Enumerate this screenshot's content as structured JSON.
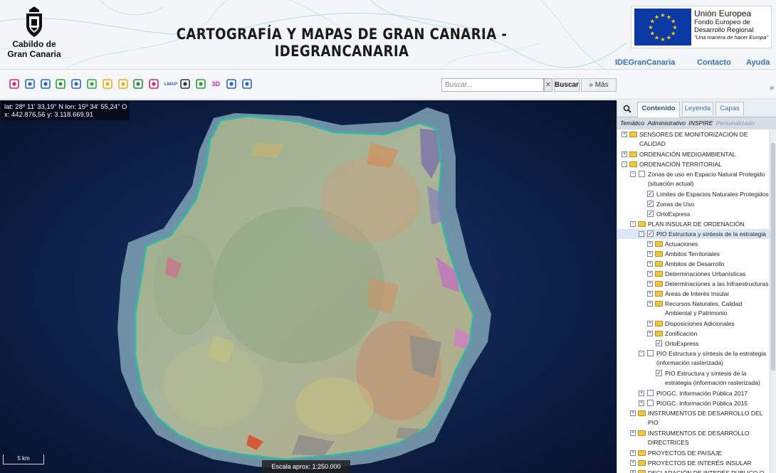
{
  "header": {
    "org_name_line1": "Cabildo de",
    "org_name_line2": "Gran Canaria",
    "title": "CARTOGRAFÍA Y MAPAS DE GRAN CANARIA - IDEGRANCANARIA",
    "eu": {
      "line1": "Unión Europea",
      "line2": "Fondo Europeo de",
      "line3": "Desarrollo Regional",
      "line4": "\"Una manera de hacer Europa\""
    },
    "links": [
      "IDEGranCanaria",
      "Contacto",
      "Ayuda"
    ]
  },
  "toolbar": {
    "tools": [
      {
        "icon": "zoom-extent-icon",
        "color": "#d02a7a"
      },
      {
        "icon": "zoom-in-icon",
        "color": "#2f62c8"
      },
      {
        "icon": "zoom-out-icon",
        "color": "#2f62c8"
      },
      {
        "icon": "globe-icon",
        "color": "#2e9a3a"
      },
      {
        "icon": "arrow-left-icon",
        "color": "#2f62c8"
      },
      {
        "icon": "binoculars-icon",
        "color": "#3aa640"
      },
      {
        "icon": "ruler-icon",
        "color": "#e6b121"
      },
      {
        "icon": "area-ruler-icon",
        "color": "#e6b121"
      },
      {
        "icon": "profile-icon",
        "color": "#2e8a3a"
      },
      {
        "icon": "print-icon",
        "color": "#d02a7a"
      },
      {
        "icon": "label-icon",
        "text": "LMAP",
        "color": "#2f62c8"
      },
      {
        "icon": "copy-icon",
        "color": "#333333"
      },
      {
        "icon": "layers-icon",
        "color": "#2e9a3a"
      },
      {
        "icon": "3d-icon",
        "text": "3D",
        "color": "#c02ab8"
      },
      {
        "icon": "split-icon",
        "color": "#2f62c8"
      },
      {
        "icon": "share-icon",
        "color": "#2f62c8"
      }
    ],
    "search_placeholder": "Buscar...",
    "search_button": "Buscar",
    "more_button": "Más"
  },
  "map": {
    "coords_line1": "lat: 28º 11' 33,19\" N  lon: 15º 34' 55,24\" O",
    "coords_line2": "x: 442.876,56  y: 3.118.669,91",
    "scalebar_label": "5 km",
    "scale_text": "Escala aprox: 1:250.000"
  },
  "sidebar": {
    "tabs": [
      "Contenido",
      "Leyenda",
      "Capas"
    ],
    "subtabs": [
      "Temático",
      "Administrativo",
      "INSPIRE",
      "Personalizado"
    ],
    "tree": [
      {
        "level": 0,
        "exp": "+",
        "icon": "folder",
        "label": "SENSORES DE MONITORIZACIÓN DE"
      },
      {
        "level": 0,
        "cont": true,
        "label": "CALIDAD"
      },
      {
        "level": 0,
        "exp": "+",
        "icon": "folder",
        "label": "ORDENACIÓN MEDIOAMBIENTAL"
      },
      {
        "level": 0,
        "exp": "-",
        "icon": "folder",
        "label": "ORDENACIÓN TERRITORIAL"
      },
      {
        "level": 1,
        "exp": "-",
        "icon": "check",
        "checked": false,
        "label": "Zonas de uso en Espacio Natural Protegido"
      },
      {
        "level": 1,
        "cont": true,
        "label": "(situación actual)"
      },
      {
        "level": 2,
        "icon": "check",
        "checked": true,
        "label": "Límites de Espacios Naturales Protegidos"
      },
      {
        "level": 2,
        "icon": "check",
        "checked": true,
        "label": "Zonas de Uso"
      },
      {
        "level": 2,
        "icon": "check",
        "checked": true,
        "label": "OrtoExpress"
      },
      {
        "level": 1,
        "exp": "-",
        "icon": "folder",
        "label": "PLAN INSULAR DE ORDENACIÓN"
      },
      {
        "level": 2,
        "exp": "-",
        "icon": "check",
        "checked": true,
        "hl": true,
        "label": "PIO Estructura y síntesis de la estrategia"
      },
      {
        "level": 3,
        "exp": "+",
        "icon": "folder",
        "label": "Actuaciones"
      },
      {
        "level": 3,
        "exp": "+",
        "icon": "folder",
        "label": "Ámbitos Territoriales"
      },
      {
        "level": 3,
        "exp": "+",
        "icon": "folder",
        "label": "Ámbitos de Desarrollo"
      },
      {
        "level": 3,
        "exp": "+",
        "icon": "folder",
        "label": "Determinaciones Urbanísticas"
      },
      {
        "level": 3,
        "exp": "+",
        "icon": "folder",
        "label": "Determinaciones a las Infraestructuras"
      },
      {
        "level": 3,
        "exp": "+",
        "icon": "folder",
        "label": "Áreas de Interés Insular"
      },
      {
        "level": 3,
        "exp": "+",
        "icon": "folder",
        "label": "Recursos Naturales, Calidad"
      },
      {
        "level": 3,
        "cont": true,
        "label": "Ambiental y Patrimonio"
      },
      {
        "level": 3,
        "exp": "+",
        "icon": "folder",
        "label": "Disposiciones Adicionales"
      },
      {
        "level": 3,
        "exp": "+",
        "icon": "folder",
        "label": "Zonificación"
      },
      {
        "level": 3,
        "icon": "check",
        "checked": true,
        "label": "OrtoExpress"
      },
      {
        "level": 2,
        "exp": "-",
        "icon": "check",
        "checked": false,
        "label": "PIO Estructura y síntesis de la estrategia"
      },
      {
        "level": 2,
        "cont": true,
        "label": "(información rasterizada)"
      },
      {
        "level": 3,
        "icon": "check",
        "checked": true,
        "label": "PIO Estructura y síntesis de la"
      },
      {
        "level": 3,
        "cont": true,
        "label": "estrategia (información rasterizada)"
      },
      {
        "level": 2,
        "exp": "+",
        "icon": "check",
        "checked": false,
        "label": "PIOGC. Información Pública 2017"
      },
      {
        "level": 2,
        "exp": "+",
        "icon": "check",
        "checked": false,
        "label": "PIOGC. Información Pública 2015"
      },
      {
        "level": 1,
        "exp": "+",
        "icon": "folder",
        "label": "INSTRUMENTOS DE DESARROLLO DEL"
      },
      {
        "level": 1,
        "cont": true,
        "label": "PIO"
      },
      {
        "level": 1,
        "exp": "+",
        "icon": "folder",
        "label": "INSTRUMENTOS DE DESARROLLO"
      },
      {
        "level": 1,
        "cont": true,
        "label": "DIRECTRICES"
      },
      {
        "level": 1,
        "exp": "+",
        "icon": "folder",
        "label": "PROYECTOS DE PAISAJE"
      },
      {
        "level": 1,
        "exp": "+",
        "icon": "folder",
        "label": "PROYECTOS DE INTERÉS INSULAR"
      },
      {
        "level": 1,
        "exp": "+",
        "icon": "folder",
        "label": "DECLARACIÓN DE INTERÉS PÚBLICO O"
      }
    ]
  }
}
